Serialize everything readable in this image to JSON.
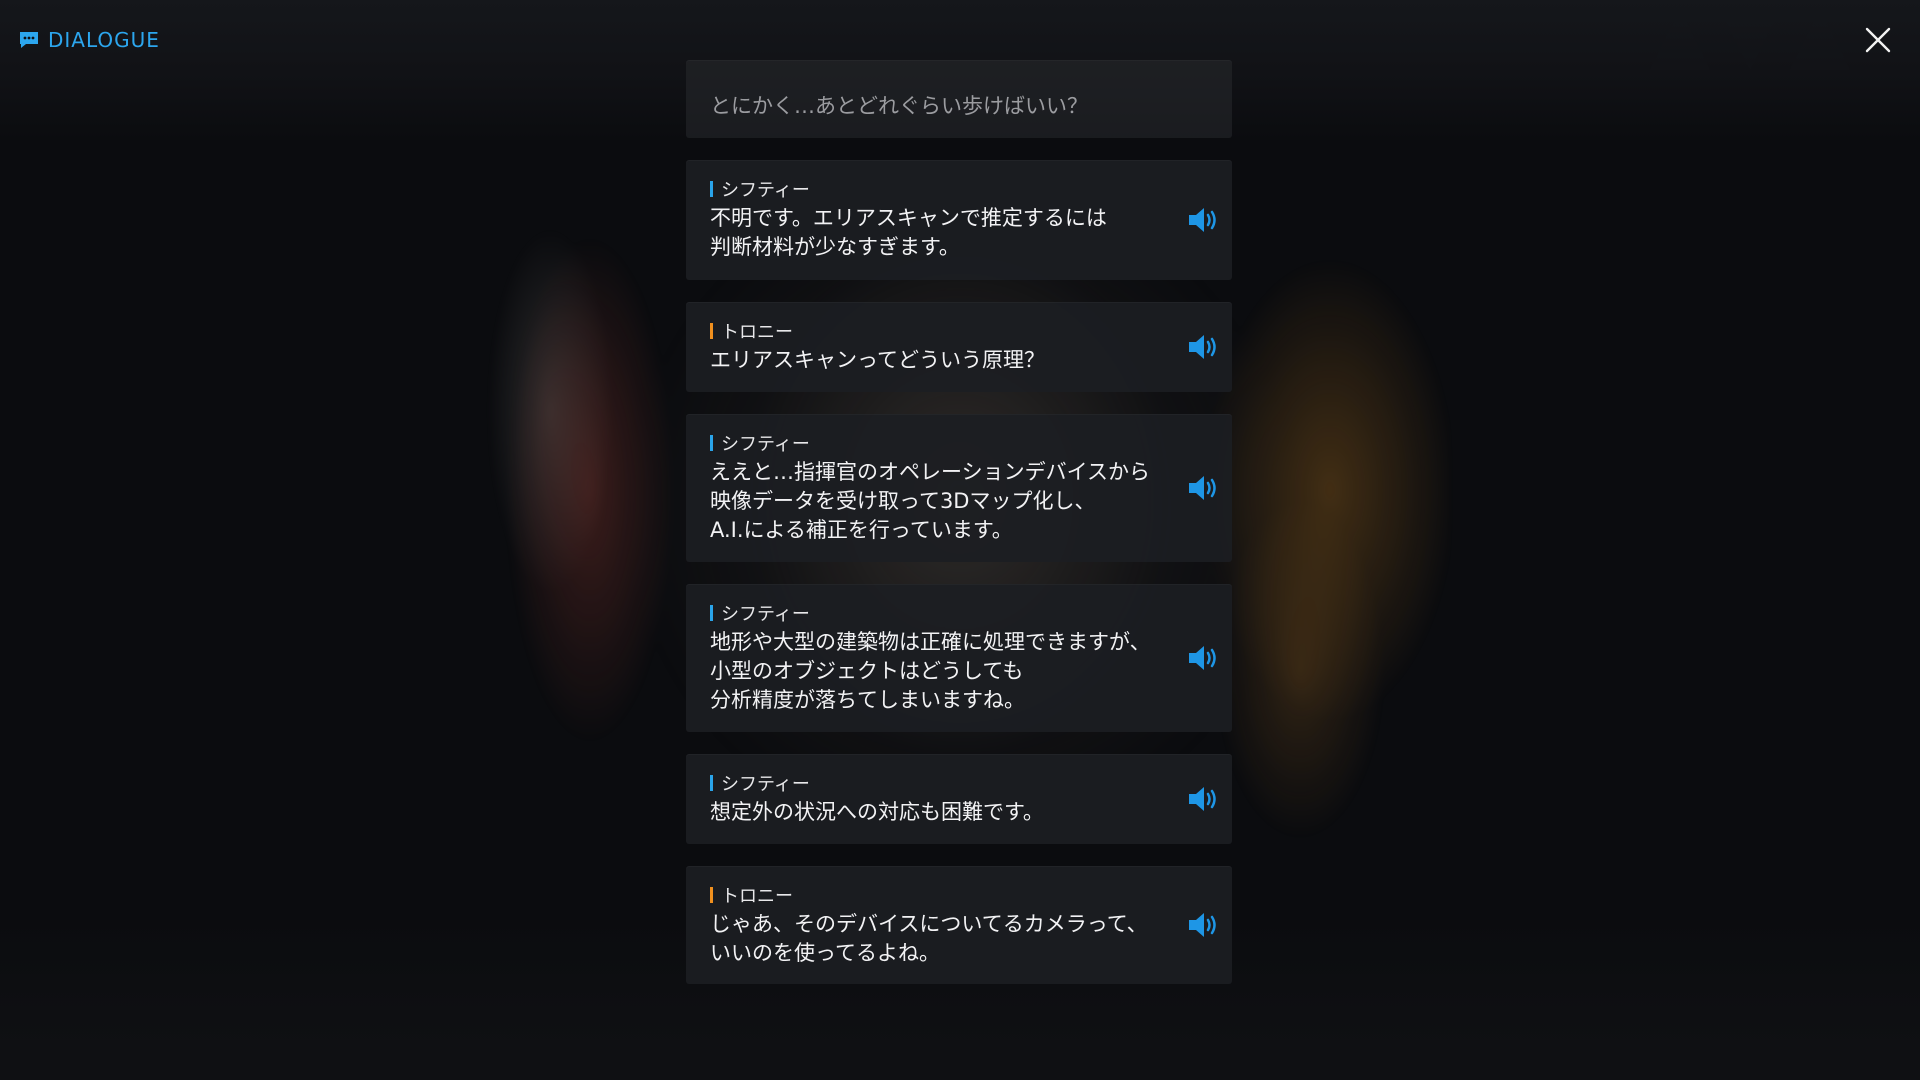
{
  "header": {
    "title": "DIALOGUE",
    "icon": "chat-bubble-icon",
    "accent": "#2ca6ee"
  },
  "close": {
    "icon": "close-icon"
  },
  "colors": {
    "siftie": "#2aa4ea",
    "tony": "#f0901e",
    "voice": "#1e96e6"
  },
  "dialogue": [
    {
      "speaker": "",
      "text": "とにかく…あとどれぐらい歩けばいい？",
      "faded": true
    },
    {
      "speaker": "シフティー",
      "speaker_color": "#2aa4ea",
      "text": "不明です。エリアスキャンで推定するには\n判断材料が少なすぎます。"
    },
    {
      "speaker": "トロニー",
      "speaker_color": "#f0901e",
      "text": "エリアスキャンってどういう原理？"
    },
    {
      "speaker": "シフティー",
      "speaker_color": "#2aa4ea",
      "text": "ええと…指揮官のオペレーションデバイスから\n映像データを受け取って3Dマップ化し、\nA.I.による補正を行っています。"
    },
    {
      "speaker": "シフティー",
      "speaker_color": "#2aa4ea",
      "text": "地形や大型の建築物は正確に処理できますが、\n小型のオブジェクトはどうしても\n分析精度が落ちてしまいますね。"
    },
    {
      "speaker": "シフティー",
      "speaker_color": "#2aa4ea",
      "text": "想定外の状況への対応も困難です。"
    },
    {
      "speaker": "トロニー",
      "speaker_color": "#f0901e",
      "text": "じゃあ、そのデバイスについてるカメラって、\nいいのを使ってるよね。"
    }
  ]
}
